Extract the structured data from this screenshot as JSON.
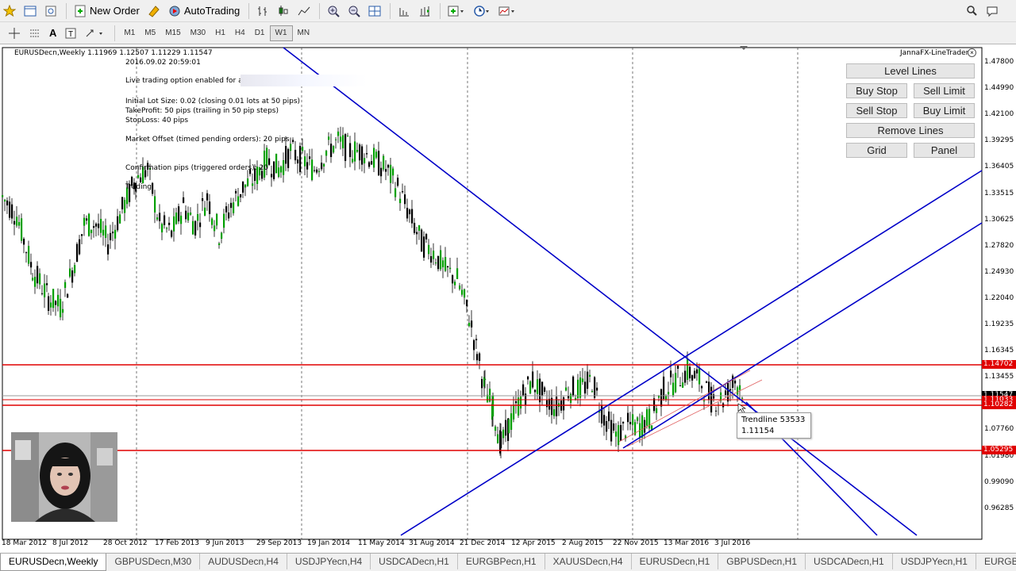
{
  "toolbar": {
    "new_order": "New Order",
    "auto_trading": "AutoTrading"
  },
  "timeframes": [
    {
      "label": "M1",
      "active": false
    },
    {
      "label": "M5",
      "active": false
    },
    {
      "label": "M15",
      "active": false
    },
    {
      "label": "M30",
      "active": false
    },
    {
      "label": "H1",
      "active": false
    },
    {
      "label": "H4",
      "active": false
    },
    {
      "label": "D1",
      "active": false
    },
    {
      "label": "W1",
      "active": true
    },
    {
      "label": "MN",
      "active": false
    }
  ],
  "chart": {
    "symbol_line": "EURUSDecn,Weekly  1.11969 1.12507 1.11229 1.11547",
    "timestamp": "2016.09.02 20:59:01",
    "info_lines": [
      "Live trading option enabled for a/c",
      "Initial Lot Size: 0.02  (closing 0.01 lots at 50 pips)",
      "TakeProfit: 50 pips  (trailing in 50 pip steps)",
      "StopLoss: 40 pips",
      "Market Offset (timed pending orders): 20 pips",
      "Confirmation pips (triggered orders): 20",
      "Trading"
    ],
    "y_labels": [
      "1.47800",
      "1.44990",
      "1.42100",
      "1.39295",
      "1.36405",
      "1.33515",
      "1.30625",
      "1.27820",
      "1.24930",
      "1.22040",
      "1.19235",
      "1.16345",
      "1.13455",
      "1.07760",
      "1.01980",
      "0.99090",
      "0.96285"
    ],
    "price_labels": {
      "upper_line": "1.14702",
      "current": "1.11547",
      "line_1": "1.11033",
      "line_2": "1.10282",
      "lower_line": "1.05295"
    },
    "x_labels": [
      "18 Mar 2012",
      "8 Jul 2012",
      "28 Oct 2012",
      "17 Feb 2013",
      "9 Jun 2013",
      "29 Sep 2013",
      "19 Jan 2014",
      "11 May 2014",
      "31 Aug 2014",
      "21 Dec 2014",
      "12 Apr 2015",
      "2 Aug 2015",
      "22 Nov 2015",
      "13 Mar 2016",
      "3 Jul 2016"
    ],
    "colors": {
      "bull": "#00a000",
      "bear": "#000000",
      "trendline": "#0000c8",
      "level": "#e00000"
    }
  },
  "panel": {
    "title": "JannaFX-LineTrader",
    "buttons": {
      "level_lines": "Level Lines",
      "buy_stop": "Buy Stop",
      "sell_limit": "Sell Limit",
      "sell_stop": "Sell Stop",
      "buy_limit": "Buy Limit",
      "remove_lines": "Remove Lines",
      "grid": "Grid",
      "panel": "Panel"
    }
  },
  "tooltip": {
    "name": "Trendline 53533",
    "value": "1.11154"
  },
  "tabs": [
    {
      "label": "EURUSDecn,Weekly",
      "active": true
    },
    {
      "label": "GBPUSDecn,M30",
      "active": false
    },
    {
      "label": "AUDUSDecn,H4",
      "active": false
    },
    {
      "label": "USDJPYecn,H4",
      "active": false
    },
    {
      "label": "USDCADecn,H1",
      "active": false
    },
    {
      "label": "EURGBPecn,H1",
      "active": false
    },
    {
      "label": "XAUUSDecn,H4",
      "active": false
    },
    {
      "label": "EURUSDecn,H1",
      "active": false
    },
    {
      "label": "GBPUSDecn,H1",
      "active": false
    },
    {
      "label": "USDCADecn,H1",
      "active": false
    },
    {
      "label": "USDJPYecn,H1",
      "active": false
    },
    {
      "label": "EURGBPecn",
      "active": false
    }
  ]
}
